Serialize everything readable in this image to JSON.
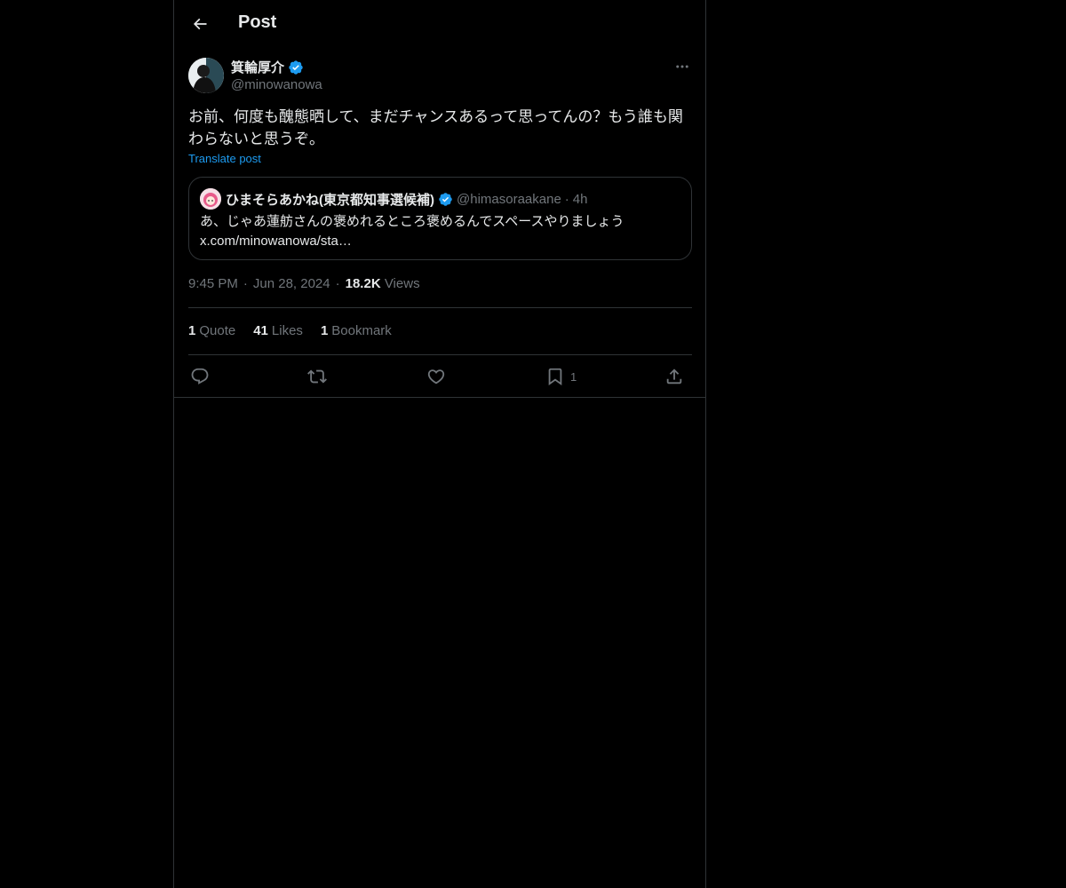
{
  "header": {
    "title": "Post"
  },
  "author": {
    "name": "箕輪厚介",
    "handle": "@minowanowa",
    "verified": true
  },
  "post": {
    "text": "お前、何度も醜態晒して、まだチャンスあるって思ってんの？もう誰も関わらないと思うぞ。",
    "translate_label": "Translate post"
  },
  "quote": {
    "name": "ひまそらあかね(東京都知事選候補)",
    "handle": "@himasoraakane",
    "dot": "·",
    "time": "4h",
    "text_line1": "あ、じゃあ蓮舫さんの褒めれるところ褒めるんでスペースやりましょう",
    "text_line2": "x.com/minowanowa/sta…"
  },
  "meta": {
    "time": "9:45 PM",
    "sep1": "·",
    "date": "Jun 28, 2024",
    "sep2": "·",
    "views_count": "18.2K",
    "views_label": "Views"
  },
  "stats": {
    "quotes_count": "1",
    "quotes_label": "Quote",
    "likes_count": "41",
    "likes_label": "Likes",
    "bookmarks_count": "1",
    "bookmarks_label": "Bookmark"
  },
  "actions": {
    "bookmark_count": "1"
  },
  "colors": {
    "background": "#000000",
    "text": "#e7e9ea",
    "muted": "#71767b",
    "border": "#2f3336",
    "accent": "#1d9bf0"
  },
  "icons": {
    "back": "arrow-left-icon",
    "verified": "verified-badge-icon",
    "more": "more-horizontal-icon",
    "reply": "reply-icon",
    "repost": "repost-icon",
    "like": "heart-icon",
    "bookmark": "bookmark-icon",
    "share": "share-icon"
  }
}
